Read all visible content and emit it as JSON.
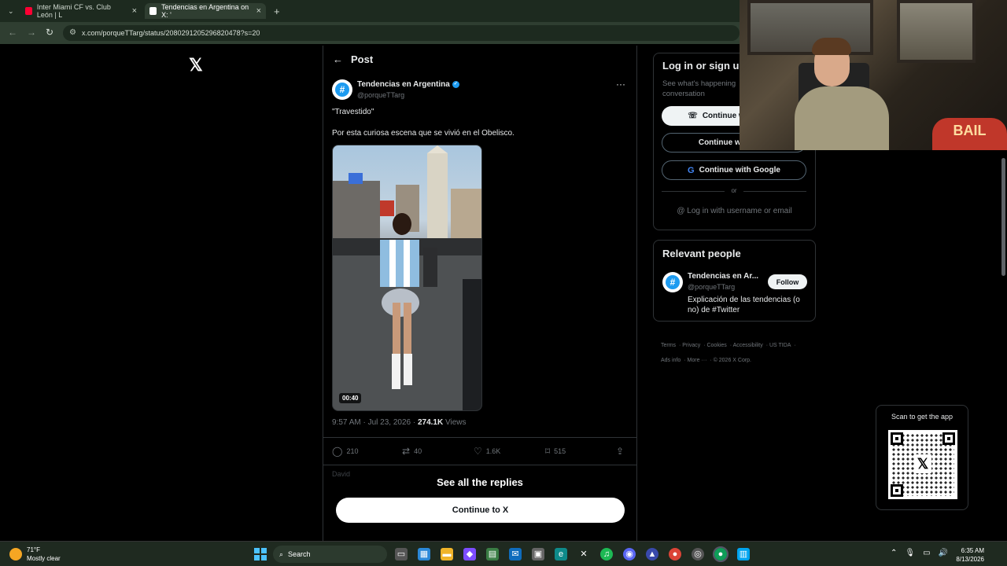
{
  "browser": {
    "tabs": [
      {
        "label": "Inter Miami CF vs. Club León | L",
        "active": false,
        "favicon": "youtube-icon",
        "color": "#ff0033"
      },
      {
        "label": "Tendencias en Argentina on X: '",
        "active": true,
        "favicon": "x-icon",
        "color": "#ffffff"
      }
    ],
    "url": "x.com/porqueTTarg/status/2080291205296820478?s=20"
  },
  "post": {
    "header_title": "Post",
    "author_name": "Tendencias en Argentina",
    "author_handle": "@porqueTTarg",
    "text_line1": "\"Travestido\"",
    "text_line2": "Por esta curiosa escena que se vivió en el Obelisco.",
    "video_duration": "00:40",
    "timestamp": "9:57 AM · Jul 23, 2026 · ",
    "views_count": "274.1K",
    "views_label": " Views",
    "stats": {
      "replies": "210",
      "reposts": "40",
      "likes": "1.6K",
      "bookmarks": "515"
    },
    "reply_preview": "David",
    "see_all": "See all the replies",
    "continue_btn": "Continue to X"
  },
  "login": {
    "title": "Log in or sign up",
    "subtitle": "See what's happening conversation",
    "phone_btn": "Continue with phone",
    "apple_btn": "Continue with Apple",
    "google_btn": "Continue with Google",
    "or": "or",
    "username_link": "Log in with username or email"
  },
  "relevant": {
    "title": "Relevant people",
    "name": "Tendencias en Ar...",
    "handle": "@porqueTTarg",
    "follow": "Follow",
    "bio": "Explicación de las tendencias (o no) de #Twitter"
  },
  "footer": {
    "links": [
      "Terms",
      "Privacy",
      "Cookies",
      "Accessibility",
      "US TIDA",
      "Ads info",
      "More ···",
      "© 2026 X Corp."
    ]
  },
  "scan": {
    "title": "Scan to get the app"
  },
  "webcam": {
    "pillow_text": "BAIL"
  },
  "taskbar": {
    "weather_temp": "71°F",
    "weather_desc": "Mostly clear",
    "search": "Search",
    "time": "6:35 AM",
    "date": "8/13/2026"
  },
  "colors": {
    "accent": "#1d9bf0",
    "background": "#000000",
    "border": "#2f3336"
  }
}
